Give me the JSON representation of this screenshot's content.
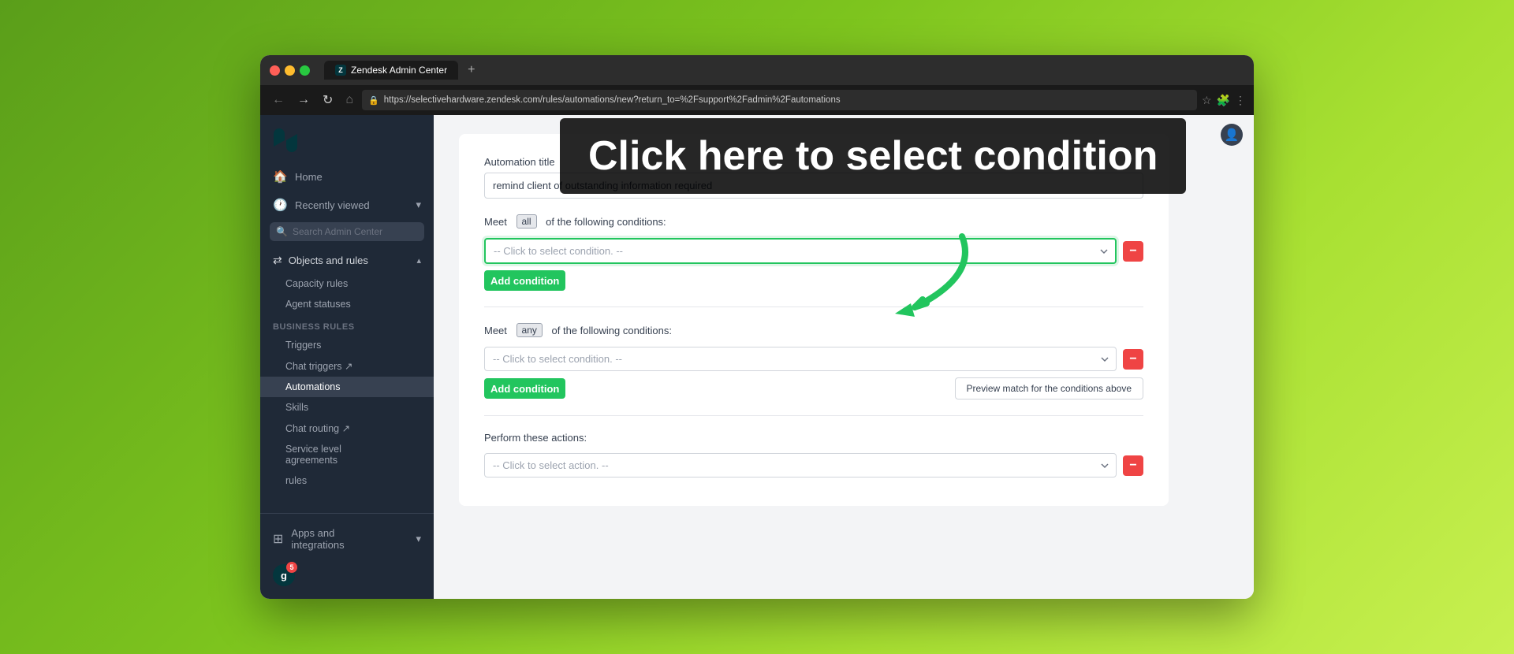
{
  "browser": {
    "tab_title": "Zendesk Admin Center",
    "tab_plus": "+",
    "url": "https://selectivehardware.zendesk.com/rules/automations/new?return_to=%2Fsupport%2Fadmin%2Fautomations",
    "nav": {
      "back": "←",
      "forward": "→",
      "refresh": "↻",
      "home": "⌂"
    },
    "star": "☆",
    "extensions": "🧩",
    "menu": "⋮"
  },
  "overlay": {
    "tooltip_text": "Click here to select condition"
  },
  "sidebar": {
    "logo_alt": "Zendesk",
    "home_label": "Home",
    "recently_viewed_label": "Recently viewed",
    "search_placeholder": "Search Admin Center",
    "objects_rules_label": "Objects and rules",
    "capacity_rules_label": "Capacity rules",
    "agent_statuses_label": "Agent statuses",
    "business_rules_label": "Business rules",
    "triggers_label": "Triggers",
    "chat_triggers_label": "Chat triggers ↗",
    "automations_label": "Automations",
    "skills_label": "Skills",
    "chat_routing_label": "Chat routing ↗",
    "service_level_label": "Service level",
    "agreements_label": "agreements",
    "sla_rules_label": "rules",
    "apps_and_label": "Apps and",
    "integrations_label": "integrations",
    "avatar_letter": "g",
    "badge_count": "5"
  },
  "main": {
    "automation_title_label": "Automation title",
    "automation_title_value": "remind client of outstanding information required",
    "meet_all_label": "Meet",
    "meet_all_badge": "all",
    "of_following_label": "of the following conditions:",
    "condition_placeholder_1": "-- Click to select condition. --",
    "add_condition_label": "Add condition",
    "meet_any_label": "Meet",
    "meet_any_badge": "any",
    "of_following_any_label": "of the following conditions:",
    "condition_placeholder_2": "-- Click to select condition. --",
    "add_condition_2_label": "Add condition",
    "preview_btn_label": "Preview match for the conditions above",
    "perform_actions_label": "Perform these actions:",
    "action_placeholder": "-- Click to select action. --"
  }
}
